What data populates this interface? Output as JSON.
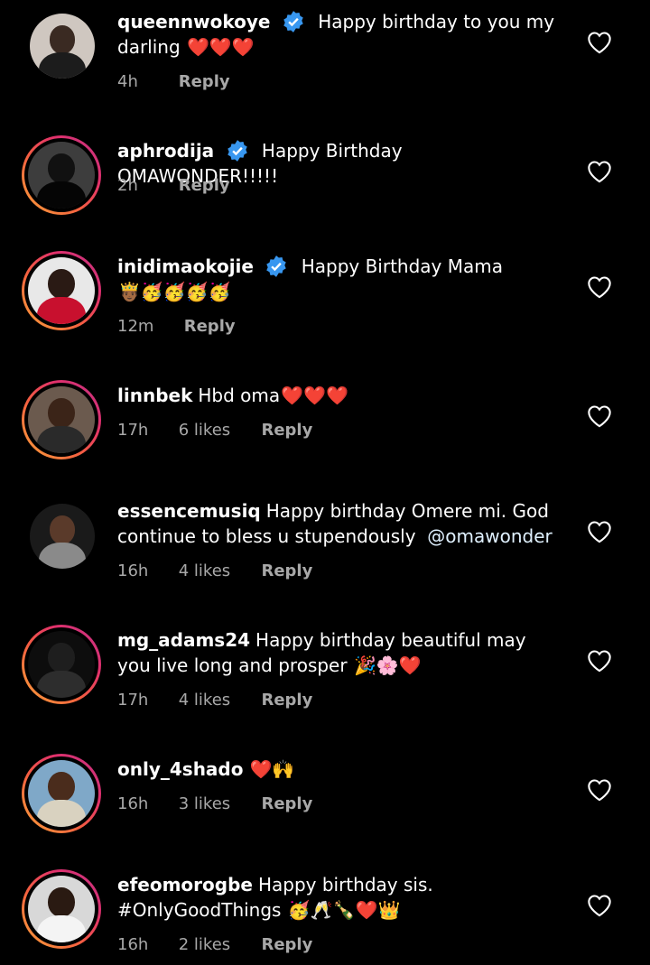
{
  "comments": [
    {
      "username": "queennwokoye",
      "verified": true,
      "text": "Happy birthday to you my darling",
      "emojis": "❤️❤️❤️",
      "time": "4h",
      "likes": "",
      "reply": "Reply"
    },
    {
      "username": "aphrodija",
      "verified": true,
      "text": "Happy Birthday OMAWONDER!!!!!",
      "emojis": "",
      "time": "2h",
      "likes": "",
      "reply": "Reply"
    },
    {
      "username": "inidimaokojie",
      "verified": true,
      "text": "Happy Birthday Mama",
      "emojis": "🤴🏾🥳🥳🥳🥳",
      "time": "12m",
      "likes": "",
      "reply": "Reply"
    },
    {
      "username": "linnbek",
      "verified": false,
      "text": "Hbd oma",
      "emojis": "❤️❤️❤️",
      "time": "17h",
      "likes": "6 likes",
      "reply": "Reply"
    },
    {
      "username": "essencemusiq",
      "verified": false,
      "text": "Happy birthday Omere mi. God continue to bless u stupendously",
      "mention": "@omawonder",
      "emojis": "",
      "time": "16h",
      "likes": "4 likes",
      "reply": "Reply"
    },
    {
      "username": "mg_adams24",
      "verified": false,
      "text": "Happy birthday beautiful may you live long and prosper",
      "emojis": "🎉🌸❤️",
      "time": "17h",
      "likes": "4 likes",
      "reply": "Reply"
    },
    {
      "username": "only_4shado",
      "verified": false,
      "text": "",
      "emojis": "❤️🙌",
      "time": "16h",
      "likes": "3 likes",
      "reply": "Reply"
    },
    {
      "username": "efeomorogbe",
      "verified": false,
      "text": "Happy birthday sis. #OnlyGoodThings",
      "emojis": "🥳🥂🍾❤️👑",
      "time": "16h",
      "likes": "2 likes",
      "reply": "Reply"
    }
  ],
  "colors": {
    "background": "#000000",
    "meta": "#a8a8a8",
    "verified": "#3897f0"
  },
  "icons": {
    "like": "heart-outline-icon",
    "verified": "verified-badge-icon"
  }
}
